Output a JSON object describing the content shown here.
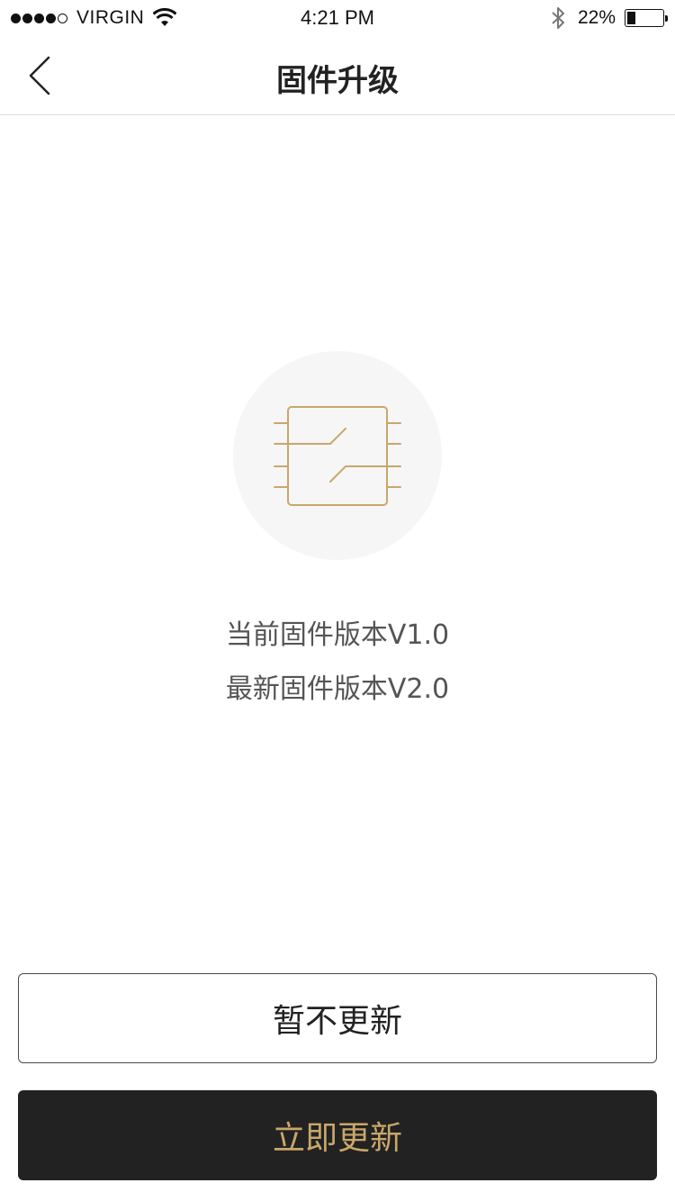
{
  "status_bar": {
    "carrier": "VIRGIN",
    "time": "4:21 PM",
    "battery_percent": "22%",
    "battery_level": 0.22,
    "signal_bars_filled": 4,
    "signal_bars_total": 5,
    "icons": [
      "signal-dots-icon",
      "wifi-icon",
      "bluetooth-icon",
      "battery-icon"
    ]
  },
  "nav": {
    "title": "固件升级",
    "back_icon": "chevron-left-icon"
  },
  "firmware": {
    "icon": "chip-icon",
    "current_version_text": "当前固件版本V1.0",
    "latest_version_text": "最新固件版本V2.0"
  },
  "actions": {
    "later_label": "暂不更新",
    "update_now_label": "立即更新"
  },
  "colors": {
    "accent_gold": "#c9a76a",
    "dark_button": "#222222",
    "icon_circle_bg": "#f6f6f6"
  }
}
